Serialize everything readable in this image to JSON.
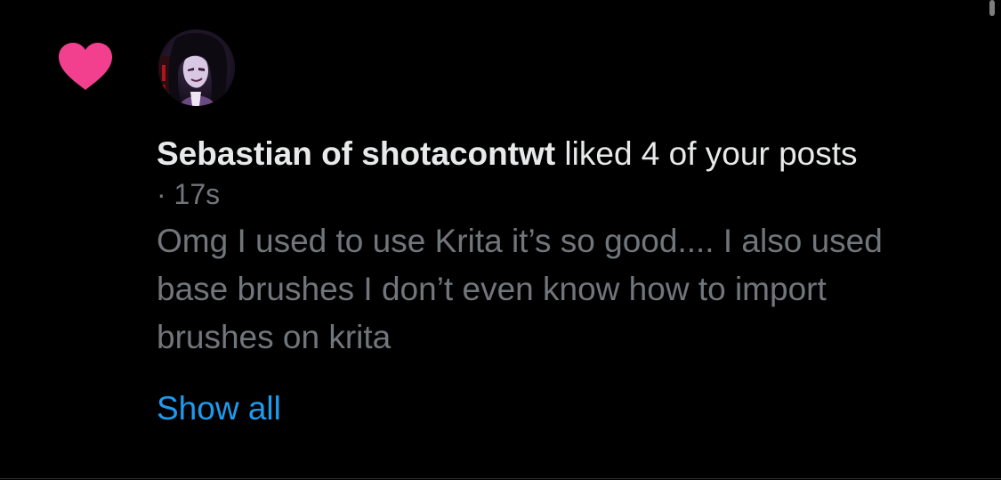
{
  "notification": {
    "type": "like",
    "icon": "heart-icon",
    "icon_color": "#f91880",
    "actor_name": "Sebastian of shotacontwt",
    "action_text": " liked 4 of your posts",
    "timestamp": "· 17s",
    "excerpt": "Omg I used to use Krita it’s so good.... I also used base brushes I don’t even know how to import brushes on krita",
    "show_all_label": "Show all"
  },
  "colors": {
    "background": "#000000",
    "primary_text": "#e7e9ea",
    "secondary_text": "#71767b",
    "link": "#1d9bf0",
    "like": "#f91880"
  }
}
